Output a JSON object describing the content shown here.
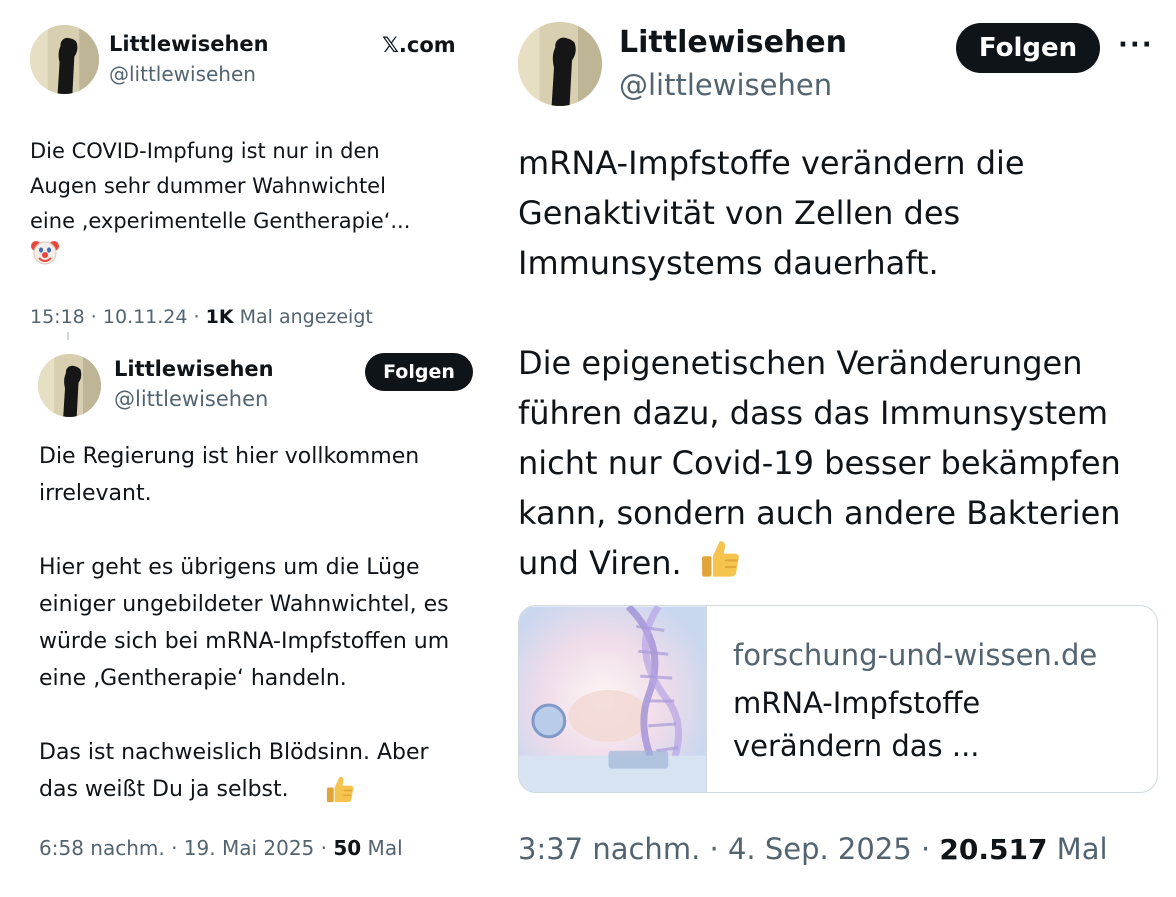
{
  "tweet1": {
    "name": "Littlewisehen",
    "handle": "@littlewisehen",
    "source": "𝕏.com",
    "text": "Die COVID-Impfung ist nur in den\nAugen sehr dummer Wahnwichtel\neine ‚experimentelle Gentherapie‘...",
    "emoji": "clown-face",
    "time": "15:18 · 10.11.24 · ",
    "views": "1K",
    "views_label": " Mal angezeigt"
  },
  "tweet2": {
    "name": "Littlewisehen",
    "handle": "@littlewisehen",
    "follow_label": "Folgen",
    "text": "Die Regierung ist hier vollkommen\nirrelevant.\n\nHier geht es übrigens um die Lüge\neiniger ungebildeter Wahnwichtel, es\nwürde sich bei mRNA-Impfstoffen um\neine ‚Gentherapie‘ handeln.\n\nDas ist nachweislich Blödsinn. Aber\ndas weißt Du ja selbst.",
    "emoji": "thumbs-up",
    "time": "6:58 nachm. · 19. Mai 2025 · ",
    "views": "50",
    "views_label": " Mal"
  },
  "tweet3": {
    "name": "Littlewisehen",
    "handle": "@littlewisehen",
    "follow_label": "Folgen",
    "more_label": "···",
    "text": "mRNA-Impfstoffe verändern die\nGenaktivität von Zellen des\nImmunsystems dauerhaft.\n\nDie epigenetischen Veränderungen\nführen dazu, dass das Immunsystem\nnicht nur Covid-19 besser bekämpfen\nkann, sondern auch andere Bakterien\nund Viren.",
    "emoji": "thumbs-up",
    "card": {
      "domain": "forschung-und-wissen.de",
      "title": "mRNA-Impfstoffe\nverändern das ..."
    },
    "time": "3:37 nachm. · 4. Sep. 2025 · ",
    "views": "20.517",
    "views_label": " Mal"
  },
  "colors": {
    "text": "#0f1419",
    "secondary": "#536471",
    "border": "#cfd9de",
    "button": "#0f1419"
  }
}
